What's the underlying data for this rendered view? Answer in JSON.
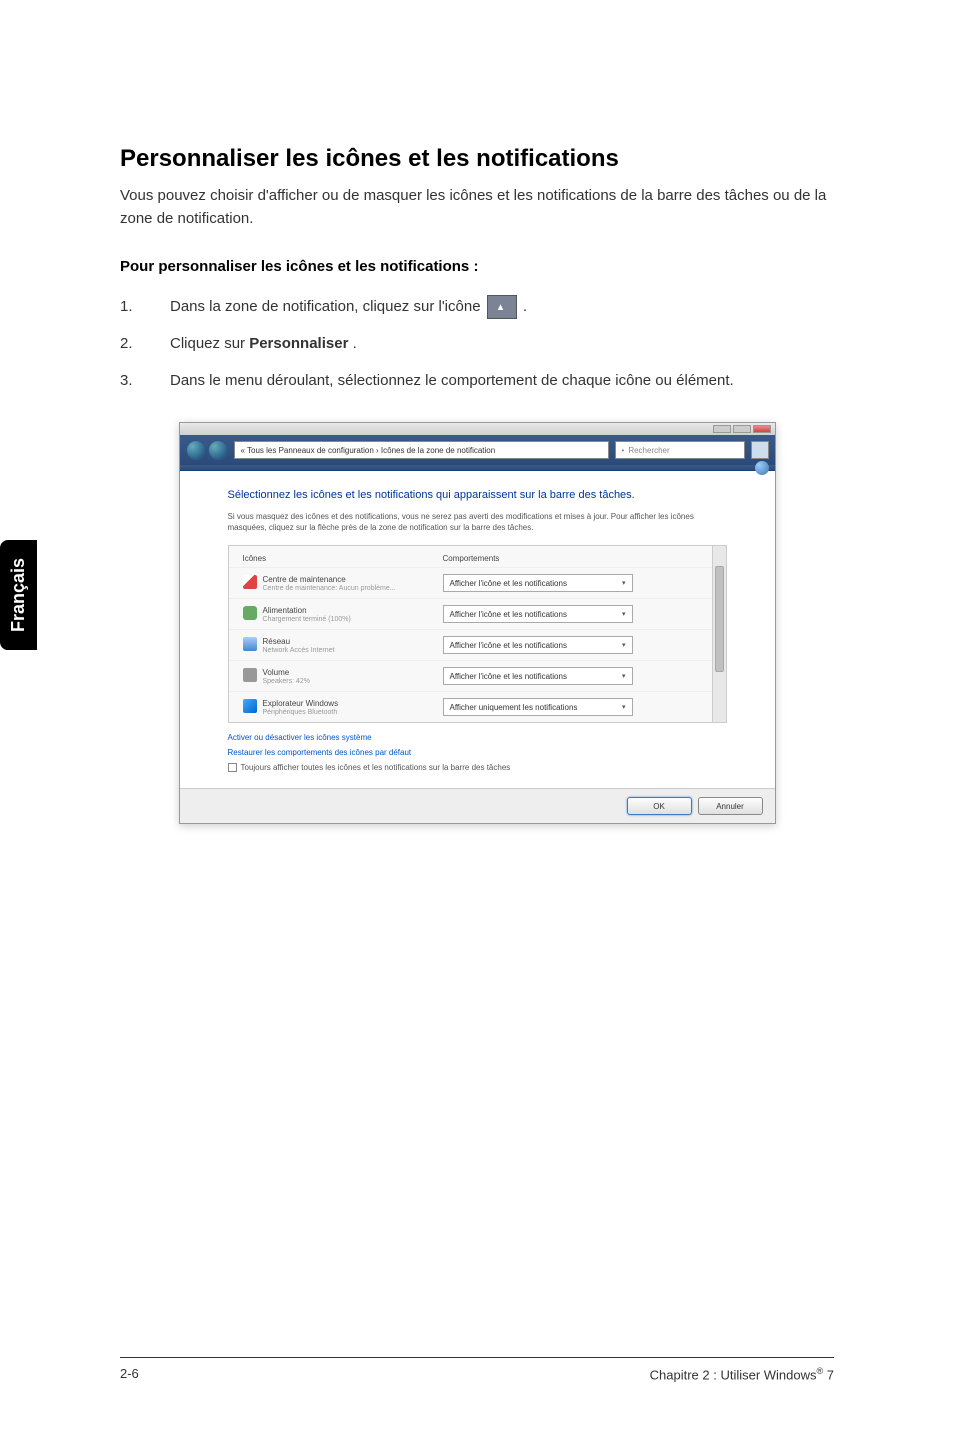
{
  "heading": "Personnaliser les icônes et les notifications",
  "intro": "Vous pouvez choisir d'afficher ou de masquer les icônes et les notifications de la barre des tâches ou de la zone de notification.",
  "subheading": "Pour personnaliser les icônes et les notifications :",
  "steps": {
    "s1_num": "1.",
    "s1_text_before": "Dans la zone de notification, cliquez sur l'icône ",
    "s1_text_after": ".",
    "s2_num": "2.",
    "s2_text_before": "Cliquez sur ",
    "s2_bold": "Personnaliser",
    "s2_text_after": ".",
    "s3_num": "3.",
    "s3_text": "Dans le menu déroulant, sélectionnez le comportement de chaque icône ou élément."
  },
  "sidetab": "Français",
  "window": {
    "breadcrumb": "« Tous les Panneaux de configuration › Icônes de la zone de notification",
    "search_placeholder": "Rechercher",
    "title": "Sélectionnez les icônes et les notifications qui apparaissent sur la barre des tâches.",
    "desc": "Si vous masquez des icônes et des notifications, vous ne serez pas averti des modifications et mises à jour. Pour afficher les icônes masquées, cliquez sur la flèche près de la zone de notification sur la barre des tâches.",
    "col_icon": "Icônes",
    "col_behavior": "Comportements",
    "rows": [
      {
        "label": "Centre de maintenance",
        "sub": "Centre de maintenance: Aucun problème...",
        "behavior": "Afficher l'icône et les notifications"
      },
      {
        "label": "Alimentation",
        "sub": "Chargement terminé (100%)",
        "behavior": "Afficher l'icône et les notifications"
      },
      {
        "label": "Réseau",
        "sub": "Network Accès Internet",
        "behavior": "Afficher l'icône et les notifications"
      },
      {
        "label": "Volume",
        "sub": "Speakers: 42%",
        "behavior": "Afficher l'icône et les notifications"
      },
      {
        "label": "Explorateur Windows",
        "sub": "Périphériques Bluetooth",
        "behavior": "Afficher uniquement les notifications"
      }
    ],
    "link1": "Activer ou désactiver les icônes système",
    "link2": "Restaurer les comportements des icônes par défaut",
    "checkbox_label": "Toujours afficher toutes les icônes et les notifications sur la barre des tâches",
    "btn_ok": "OK",
    "btn_cancel": "Annuler"
  },
  "footer": {
    "left": "2-6",
    "right_prefix": "Chapitre 2 : Utiliser Windows",
    "right_sup": "®",
    "right_suffix": " 7"
  }
}
